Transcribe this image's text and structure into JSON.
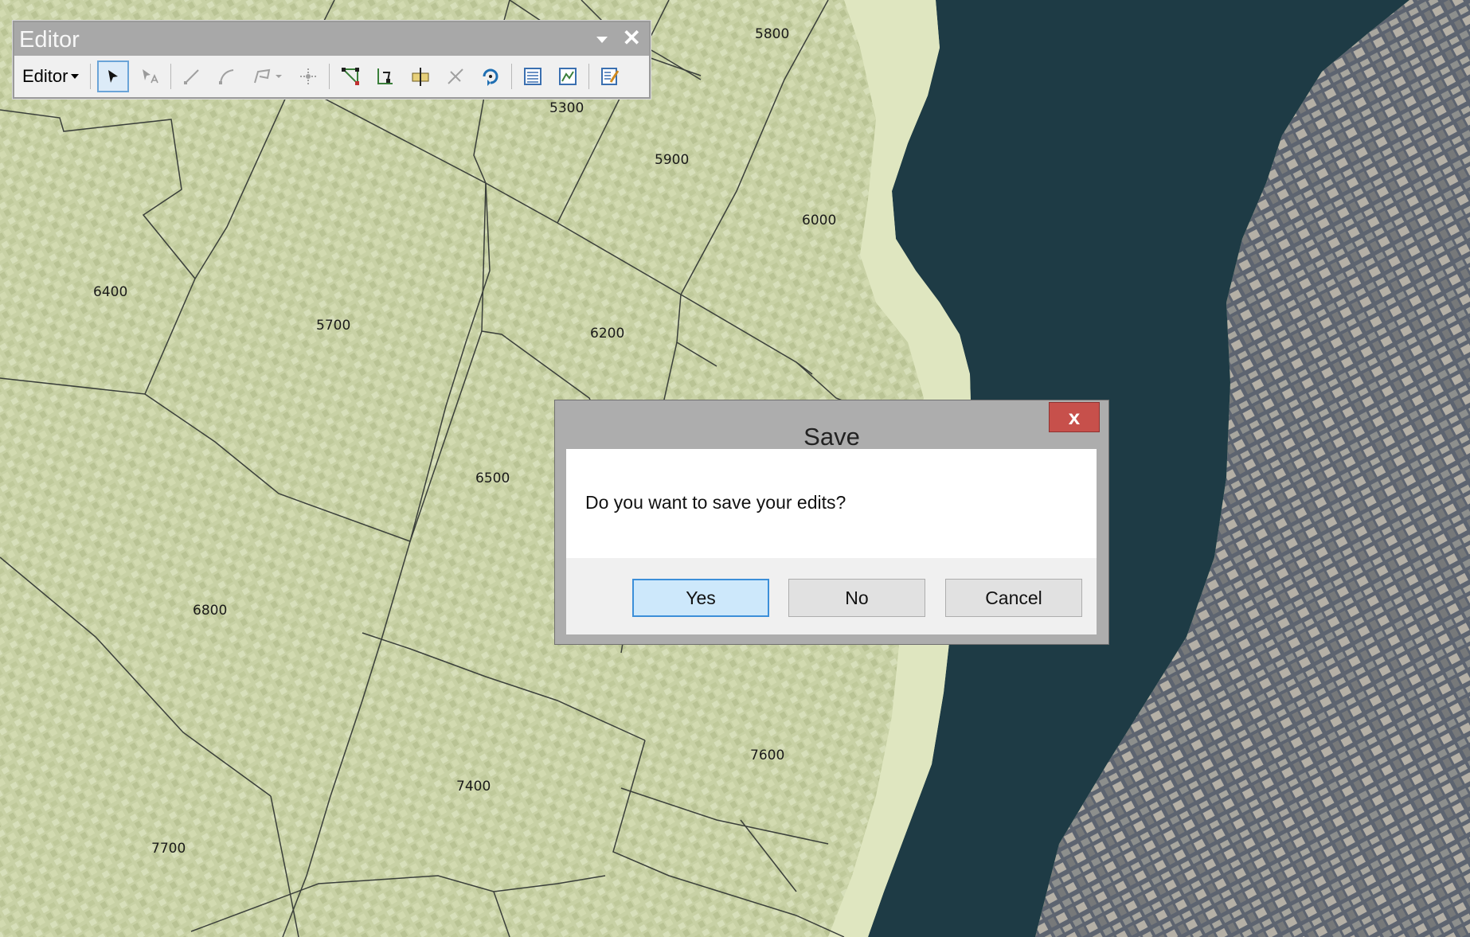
{
  "toolbar": {
    "window_title": "Editor",
    "editor_menu_label": "Editor",
    "tools": [
      "edit-pointer-icon",
      "edit-annotation-icon",
      "straight-segment-icon",
      "end-point-arc-icon",
      "trace-icon",
      "point-icon",
      "edit-vertices-icon",
      "reshape-feature-icon",
      "cut-polygons-icon",
      "split-icon",
      "rotate-icon",
      "attributes-icon",
      "sketch-properties-icon",
      "create-features-icon"
    ]
  },
  "map": {
    "labels": [
      "5800",
      "5300",
      "5900",
      "6000",
      "6400",
      "5700",
      "6200",
      "6500",
      "6800",
      "7600",
      "7400",
      "7700"
    ]
  },
  "dialog": {
    "title": "Save",
    "message": "Do you want to save your edits?",
    "buttons": {
      "yes": "Yes",
      "no": "No",
      "cancel": "Cancel"
    },
    "close_glyph": "x"
  },
  "colors": {
    "overlay": "#d9e2b4",
    "water": "#1e3b45",
    "dialog_close": "#c7504b",
    "default_button": "#cde8fb"
  }
}
